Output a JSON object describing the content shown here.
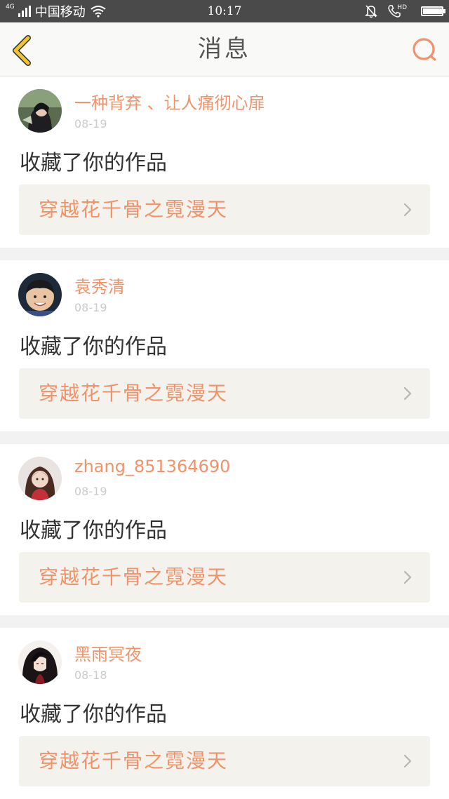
{
  "status_bar": {
    "network_type": "4G",
    "carrier": "中国移动",
    "time": "10:17",
    "hd_label": "HD",
    "battery_level": 0.95,
    "icons": [
      "signal-icon",
      "wifi-icon",
      "bell-muted-icon",
      "phone-hd-icon",
      "battery-icon"
    ]
  },
  "header": {
    "title": "消息",
    "back_icon": "chevron-left-icon",
    "search_icon": "search-icon"
  },
  "colors": {
    "accent": "#f0936a",
    "back_icon": "#f2c230",
    "status_bar_bg": "#4a4a4a",
    "work_bg": "#f3f2ed"
  },
  "messages": [
    {
      "username": "一种背弃 、让人痛彻心扉",
      "date": "08-19",
      "action": "收藏了你的作品",
      "work_title": "穿越花千骨之霓漫天",
      "avatar": "avatar-dark-hair"
    },
    {
      "username": "袁秀清",
      "date": "08-19",
      "action": "收藏了你的作品",
      "work_title": "穿越花千骨之霓漫天",
      "avatar": "avatar-child"
    },
    {
      "username": "zhang_851364690",
      "date": "08-19",
      "action": "收藏了你的作品",
      "work_title": "穿越花千骨之霓漫天",
      "avatar": "avatar-girl"
    },
    {
      "username": "黑雨冥夜",
      "date": "08-18",
      "action": "收藏了你的作品",
      "work_title": "穿越花千骨之霓漫天",
      "avatar": "avatar-anime"
    }
  ]
}
